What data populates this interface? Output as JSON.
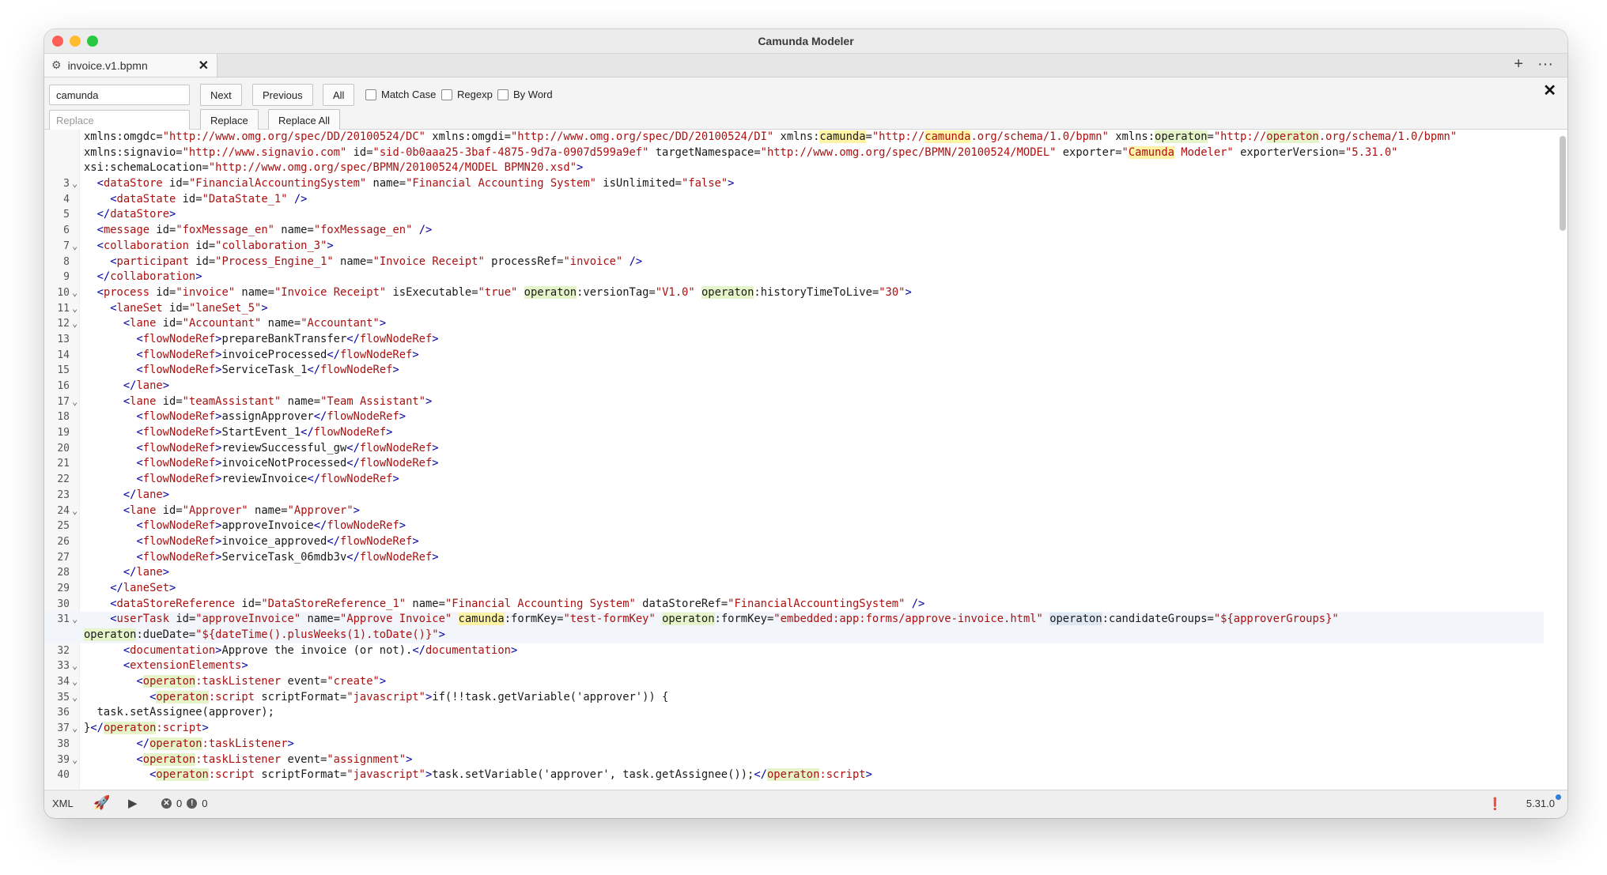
{
  "window": {
    "title": "Camunda Modeler"
  },
  "tab": {
    "label": "invoice.v1.bpmn",
    "close": "✕"
  },
  "tab_actions": {
    "add": "+",
    "more": "···"
  },
  "search": {
    "find_value": "camunda",
    "replace_placeholder": "Replace",
    "next": "Next",
    "previous": "Previous",
    "all": "All",
    "match_case": "Match Case",
    "regexp": "Regexp",
    "by_word": "By Word",
    "replace": "Replace",
    "replace_all": "Replace All",
    "close": "✕"
  },
  "editor": {
    "lines": [
      {
        "ln": "",
        "fold": "",
        "html": "<span class=\"an\">xmlns:omgdc</span>=<span class=\"av\">\"http://www.omg.org/spec/DD/20100524/DC\"</span> <span class=\"an\">xmlns:omgdi</span>=<span class=\"av\">\"http://www.omg.org/spec/DD/20100524/DI\"</span> <span class=\"an\">xmlns:<span class=\"ht\">camunda</span></span>=<span class=\"av\">\"http://<span class=\"ht\">camunda</span>.org/schema/1.0/bpmn\"</span> <span class=\"an\">xmlns:<span class=\"hl\">operaton</span></span>=<span class=\"av\">\"http://<span class=\"hl\">operaton</span>.org/schema/1.0/bpmn\"</span>"
      },
      {
        "ln": "",
        "fold": "",
        "html": "<span class=\"an\">xmlns:signavio</span>=<span class=\"av\">\"http://www.signavio.com\"</span> <span class=\"an\">id</span>=<span class=\"av\">\"sid-0b0aaa25-3baf-4875-9d7a-0907d599a9ef\"</span> <span class=\"an\">targetNamespace</span>=<span class=\"av\">\"http://www.omg.org/spec/BPMN/20100524/MODEL\"</span> <span class=\"an\">exporter</span>=<span class=\"av\">\"<span class=\"ht\">Camunda</span> Modeler\"</span> <span class=\"an\">exporterVersion</span>=<span class=\"av\">\"5.31.0\"</span>"
      },
      {
        "ln": "",
        "fold": "",
        "html": "<span class=\"an\">xsi:schemaLocation</span>=<span class=\"av\">\"http://www.omg.org/spec/BPMN/20100524/MODEL BPMN20.xsd\"</span><span class=\"tg\">&gt;</span>"
      },
      {
        "ln": "3",
        "fold": "⌄",
        "html": "  <span class=\"tg\">&lt;</span><span class=\"tn\">dataStore</span> <span class=\"an\">id</span>=<span class=\"av\">\"FinancialAccountingSystem\"</span> <span class=\"an\">name</span>=<span class=\"av\">\"Financial Accounting System\"</span> <span class=\"an\">isUnlimited</span>=<span class=\"av\">\"false\"</span><span class=\"tg\">&gt;</span>"
      },
      {
        "ln": "4",
        "fold": "",
        "html": "    <span class=\"tg\">&lt;</span><span class=\"tn\">dataState</span> <span class=\"an\">id</span>=<span class=\"av\">\"DataState_1\"</span> <span class=\"tg\">/&gt;</span>"
      },
      {
        "ln": "5",
        "fold": "",
        "html": "  <span class=\"tg\">&lt;/</span><span class=\"tn\">dataStore</span><span class=\"tg\">&gt;</span>"
      },
      {
        "ln": "6",
        "fold": "",
        "html": "  <span class=\"tg\">&lt;</span><span class=\"tn\">message</span> <span class=\"an\">id</span>=<span class=\"av\">\"foxMessage_en\"</span> <span class=\"an\">name</span>=<span class=\"av\">\"foxMessage_en\"</span> <span class=\"tg\">/&gt;</span>"
      },
      {
        "ln": "7",
        "fold": "⌄",
        "html": "  <span class=\"tg\">&lt;</span><span class=\"tn\">collaboration</span> <span class=\"an\">id</span>=<span class=\"av\">\"collaboration_3\"</span><span class=\"tg\">&gt;</span>"
      },
      {
        "ln": "8",
        "fold": "",
        "html": "    <span class=\"tg\">&lt;</span><span class=\"tn\">participant</span> <span class=\"an\">id</span>=<span class=\"av\">\"Process_Engine_1\"</span> <span class=\"an\">name</span>=<span class=\"av\">\"Invoice Receipt\"</span> <span class=\"an\">processRef</span>=<span class=\"av\">\"invoice\"</span> <span class=\"tg\">/&gt;</span>"
      },
      {
        "ln": "9",
        "fold": "",
        "html": "  <span class=\"tg\">&lt;/</span><span class=\"tn\">collaboration</span><span class=\"tg\">&gt;</span>"
      },
      {
        "ln": "10",
        "fold": "⌄",
        "html": "  <span class=\"tg\">&lt;</span><span class=\"tn\">process</span> <span class=\"an\">id</span>=<span class=\"av\">\"invoice\"</span> <span class=\"an\">name</span>=<span class=\"av\">\"Invoice Receipt\"</span> <span class=\"an\">isExecutable</span>=<span class=\"av\">\"true\"</span> <span class=\"an\"><span class=\"hl\">operaton</span>:versionTag</span>=<span class=\"av\">\"V1.0\"</span> <span class=\"an\"><span class=\"hl\">operaton</span>:historyTimeToLive</span>=<span class=\"av\">\"30\"</span><span class=\"tg\">&gt;</span>"
      },
      {
        "ln": "11",
        "fold": "⌄",
        "html": "    <span class=\"tg\">&lt;</span><span class=\"tn\">laneSet</span> <span class=\"an\">id</span>=<span class=\"av\">\"laneSet_5\"</span><span class=\"tg\">&gt;</span>"
      },
      {
        "ln": "12",
        "fold": "⌄",
        "html": "      <span class=\"tg\">&lt;</span><span class=\"tn\">lane</span> <span class=\"an\">id</span>=<span class=\"av\">\"Accountant\"</span> <span class=\"an\">name</span>=<span class=\"av\">\"Accountant\"</span><span class=\"tg\">&gt;</span>"
      },
      {
        "ln": "13",
        "fold": "",
        "html": "        <span class=\"tg\">&lt;</span><span class=\"tn\">flowNodeRef</span><span class=\"tg\">&gt;</span>prepareBankTransfer<span class=\"tg\">&lt;/</span><span class=\"tn\">flowNodeRef</span><span class=\"tg\">&gt;</span>"
      },
      {
        "ln": "14",
        "fold": "",
        "html": "        <span class=\"tg\">&lt;</span><span class=\"tn\">flowNodeRef</span><span class=\"tg\">&gt;</span>invoiceProcessed<span class=\"tg\">&lt;/</span><span class=\"tn\">flowNodeRef</span><span class=\"tg\">&gt;</span>"
      },
      {
        "ln": "15",
        "fold": "",
        "html": "        <span class=\"tg\">&lt;</span><span class=\"tn\">flowNodeRef</span><span class=\"tg\">&gt;</span>ServiceTask_1<span class=\"tg\">&lt;/</span><span class=\"tn\">flowNodeRef</span><span class=\"tg\">&gt;</span>"
      },
      {
        "ln": "16",
        "fold": "",
        "html": "      <span class=\"tg\">&lt;/</span><span class=\"tn\">lane</span><span class=\"tg\">&gt;</span>"
      },
      {
        "ln": "17",
        "fold": "⌄",
        "html": "      <span class=\"tg\">&lt;</span><span class=\"tn\">lane</span> <span class=\"an\">id</span>=<span class=\"av\">\"teamAssistant\"</span> <span class=\"an\">name</span>=<span class=\"av\">\"Team Assistant\"</span><span class=\"tg\">&gt;</span>"
      },
      {
        "ln": "18",
        "fold": "",
        "html": "        <span class=\"tg\">&lt;</span><span class=\"tn\">flowNodeRef</span><span class=\"tg\">&gt;</span>assignApprover<span class=\"tg\">&lt;/</span><span class=\"tn\">flowNodeRef</span><span class=\"tg\">&gt;</span>"
      },
      {
        "ln": "19",
        "fold": "",
        "html": "        <span class=\"tg\">&lt;</span><span class=\"tn\">flowNodeRef</span><span class=\"tg\">&gt;</span>StartEvent_1<span class=\"tg\">&lt;/</span><span class=\"tn\">flowNodeRef</span><span class=\"tg\">&gt;</span>"
      },
      {
        "ln": "20",
        "fold": "",
        "html": "        <span class=\"tg\">&lt;</span><span class=\"tn\">flowNodeRef</span><span class=\"tg\">&gt;</span>reviewSuccessful_gw<span class=\"tg\">&lt;/</span><span class=\"tn\">flowNodeRef</span><span class=\"tg\">&gt;</span>"
      },
      {
        "ln": "21",
        "fold": "",
        "html": "        <span class=\"tg\">&lt;</span><span class=\"tn\">flowNodeRef</span><span class=\"tg\">&gt;</span>invoiceNotProcessed<span class=\"tg\">&lt;/</span><span class=\"tn\">flowNodeRef</span><span class=\"tg\">&gt;</span>"
      },
      {
        "ln": "22",
        "fold": "",
        "html": "        <span class=\"tg\">&lt;</span><span class=\"tn\">flowNodeRef</span><span class=\"tg\">&gt;</span>reviewInvoice<span class=\"tg\">&lt;/</span><span class=\"tn\">flowNodeRef</span><span class=\"tg\">&gt;</span>"
      },
      {
        "ln": "23",
        "fold": "",
        "html": "      <span class=\"tg\">&lt;/</span><span class=\"tn\">lane</span><span class=\"tg\">&gt;</span>"
      },
      {
        "ln": "24",
        "fold": "⌄",
        "html": "      <span class=\"tg\">&lt;</span><span class=\"tn\">lane</span> <span class=\"an\">id</span>=<span class=\"av\">\"Approver\"</span> <span class=\"an\">name</span>=<span class=\"av\">\"Approver\"</span><span class=\"tg\">&gt;</span>"
      },
      {
        "ln": "25",
        "fold": "",
        "html": "        <span class=\"tg\">&lt;</span><span class=\"tn\">flowNodeRef</span><span class=\"tg\">&gt;</span>approveInvoice<span class=\"tg\">&lt;/</span><span class=\"tn\">flowNodeRef</span><span class=\"tg\">&gt;</span>"
      },
      {
        "ln": "26",
        "fold": "",
        "html": "        <span class=\"tg\">&lt;</span><span class=\"tn\">flowNodeRef</span><span class=\"tg\">&gt;</span>invoice_approved<span class=\"tg\">&lt;/</span><span class=\"tn\">flowNodeRef</span><span class=\"tg\">&gt;</span>"
      },
      {
        "ln": "27",
        "fold": "",
        "html": "        <span class=\"tg\">&lt;</span><span class=\"tn\">flowNodeRef</span><span class=\"tg\">&gt;</span>ServiceTask_06mdb3v<span class=\"tg\">&lt;/</span><span class=\"tn\">flowNodeRef</span><span class=\"tg\">&gt;</span>"
      },
      {
        "ln": "28",
        "fold": "",
        "html": "      <span class=\"tg\">&lt;/</span><span class=\"tn\">lane</span><span class=\"tg\">&gt;</span>"
      },
      {
        "ln": "29",
        "fold": "",
        "html": "    <span class=\"tg\">&lt;/</span><span class=\"tn\">laneSet</span><span class=\"tg\">&gt;</span>"
      },
      {
        "ln": "30",
        "fold": "",
        "html": "    <span class=\"tg\">&lt;</span><span class=\"tn\">dataStoreReference</span> <span class=\"an\">id</span>=<span class=\"av\">\"DataStoreReference_1\"</span> <span class=\"an\">name</span>=<span class=\"av\">\"Financial Accounting System\"</span> <span class=\"an\">dataStoreRef</span>=<span class=\"av\">\"FinancialAccountingSystem\"</span> <span class=\"tg\">/&gt;</span>"
      },
      {
        "ln": "31",
        "fold": "⌄",
        "active": true,
        "html": "    <span class=\"tg\">&lt;</span><span class=\"tn\">userTask</span> <span class=\"an\">id</span>=<span class=\"av\">\"approveInvoice\"</span> <span class=\"an\">name</span>=<span class=\"av\">\"Approve Invoice\"</span> <span class=\"an\"><span class=\"ht\">camunda</span>:formKey</span>=<span class=\"av\">\"test-formKey\"</span> <span class=\"an\"><span class=\"hl\">operaton</span>:formKey</span>=<span class=\"av\">\"embedded:app:forms/approve-invoice.html\"</span> <span class=\"an\"><span class=\"hs\">operaton</span>:candidateGroups</span>=<span class=\"av\">\"${approverGroups}\"</span>"
      },
      {
        "ln": "",
        "fold": "",
        "active": true,
        "html": "<span class=\"an\"><span class=\"hl\">operaton</span>:dueDate</span>=<span class=\"av\">\"${dateTime().plusWeeks(1).toDate()}\"</span><span class=\"tg\">&gt;</span>"
      },
      {
        "ln": "32",
        "fold": "",
        "html": "      <span class=\"tg\">&lt;</span><span class=\"tn\">documentation</span><span class=\"tg\">&gt;</span>Approve the invoice (or not).<span class=\"tg\">&lt;/</span><span class=\"tn\">documentation</span><span class=\"tg\">&gt;</span>"
      },
      {
        "ln": "33",
        "fold": "⌄",
        "html": "      <span class=\"tg\">&lt;</span><span class=\"tn\">extensionElements</span><span class=\"tg\">&gt;</span>"
      },
      {
        "ln": "34",
        "fold": "⌄",
        "html": "        <span class=\"tg\">&lt;</span><span class=\"tn\"><span class=\"hl\">operaton</span>:taskListener</span> <span class=\"an\">event</span>=<span class=\"av\">\"create\"</span><span class=\"tg\">&gt;</span>"
      },
      {
        "ln": "35",
        "fold": "⌄",
        "html": "          <span class=\"tg\">&lt;</span><span class=\"tn\"><span class=\"hl\">operaton</span>:script</span> <span class=\"an\">scriptFormat</span>=<span class=\"av\">\"javascript\"</span><span class=\"tg\">&gt;</span>if(!!task.getVariable('approver')) {"
      },
      {
        "ln": "36",
        "fold": "",
        "html": "  task.setAssignee(approver);"
      },
      {
        "ln": "37",
        "fold": "⌄",
        "html": "}<span class=\"tg\">&lt;/</span><span class=\"tn\"><span class=\"hl\">operaton</span>:script</span><span class=\"tg\">&gt;</span>"
      },
      {
        "ln": "38",
        "fold": "",
        "html": "        <span class=\"tg\">&lt;/</span><span class=\"tn\"><span class=\"hl\">operaton</span>:taskListener</span><span class=\"tg\">&gt;</span>"
      },
      {
        "ln": "39",
        "fold": "⌄",
        "html": "        <span class=\"tg\">&lt;</span><span class=\"tn\"><span class=\"hl\">operaton</span>:taskListener</span> <span class=\"an\">event</span>=<span class=\"av\">\"assignment\"</span><span class=\"tg\">&gt;</span>"
      },
      {
        "ln": "40",
        "fold": "",
        "html": "          <span class=\"tg\">&lt;</span><span class=\"tn\"><span class=\"hl\">operaton</span>:script</span> <span class=\"an\">scriptFormat</span>=<span class=\"av\">\"javascript\"</span><span class=\"tg\">&gt;</span>task.setVariable('approver', task.getAssignee());<span class=\"tg\">&lt;/</span><span class=\"tn\"><span class=\"hl\">operaton</span>:script</span><span class=\"tg\">&gt;</span>"
      }
    ]
  },
  "status": {
    "mode": "XML",
    "deploy_icon": "rocket-icon",
    "run_icon": "play-icon",
    "errors": "0",
    "warnings": "0",
    "version": "5.31.0"
  },
  "colors": {
    "tag_name": "#a11",
    "attr_value": "#a11",
    "bracket": "#0000a8",
    "match_highlight": "#fff3a6",
    "selection_highlight": "#e6f5c9"
  }
}
